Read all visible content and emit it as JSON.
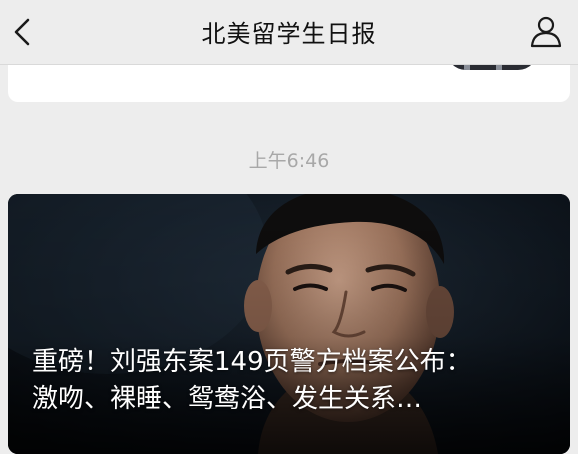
{
  "nav": {
    "title": "北美留学生日报",
    "back_icon": "chevron-left-icon",
    "profile_icon": "person-icon"
  },
  "messages": {
    "timestamp": "上午6:46"
  },
  "article": {
    "title_line1": "重磅！刘强东案149页警方档案公布：",
    "title_line2": "激吻、裸睡、鸳鸯浴、发生关系…"
  },
  "colors": {
    "background": "#ededed",
    "card": "#ffffff",
    "timestamp": "#a8a8a8"
  }
}
